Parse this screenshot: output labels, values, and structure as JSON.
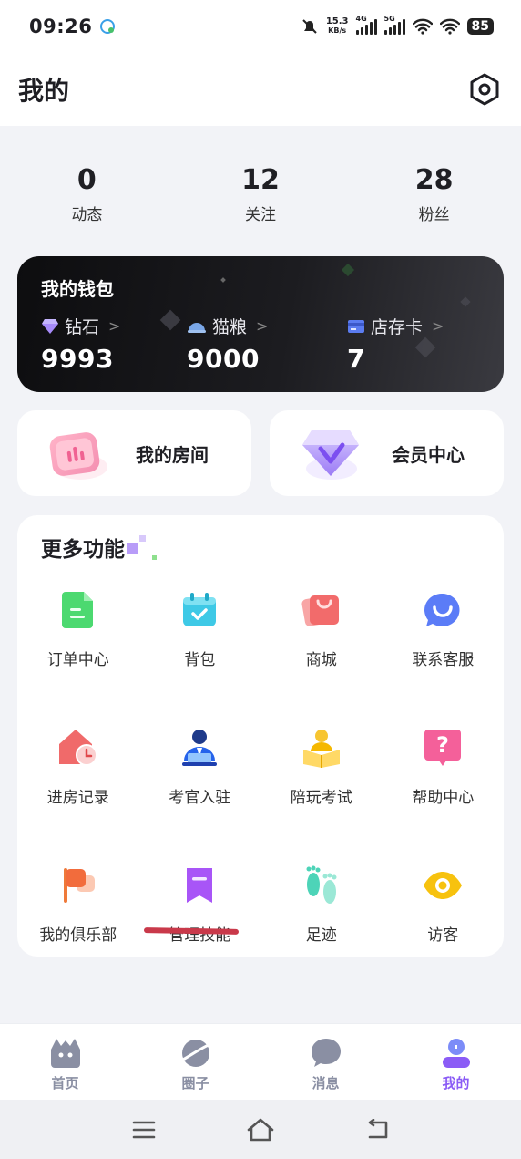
{
  "status_bar": {
    "time": "09:26",
    "net_speed_value": "15.3",
    "net_speed_unit": "KB/s",
    "sim1_type": "4G",
    "sim2_type": "5G",
    "battery": "85"
  },
  "header": {
    "title": "我的"
  },
  "stats": [
    {
      "value": "0",
      "label": "动态"
    },
    {
      "value": "12",
      "label": "关注"
    },
    {
      "value": "28",
      "label": "粉丝"
    }
  ],
  "wallet": {
    "title": "我的钱包",
    "items": [
      {
        "label": "钻石",
        "value": "9993",
        "icon": "diamond-icon"
      },
      {
        "label": "猫粮",
        "value": "9000",
        "icon": "cat-food-icon"
      },
      {
        "label": "店存卡",
        "value": "7",
        "icon": "store-card-icon"
      }
    ]
  },
  "cards": {
    "room": "我的房间",
    "vip": "会员中心"
  },
  "more": {
    "title": "更多功能",
    "items": [
      {
        "label": "订单中心",
        "icon": "order-icon"
      },
      {
        "label": "背包",
        "icon": "backpack-icon"
      },
      {
        "label": "商城",
        "icon": "shop-bag-icon"
      },
      {
        "label": "联系客服",
        "icon": "customer-service-icon"
      },
      {
        "label": "进房记录",
        "icon": "room-history-icon"
      },
      {
        "label": "考官入驻",
        "icon": "examiner-icon"
      },
      {
        "label": "陪玩考试",
        "icon": "exam-icon"
      },
      {
        "label": "帮助中心",
        "icon": "help-icon"
      },
      {
        "label": "我的俱乐部",
        "icon": "club-flag-icon"
      },
      {
        "label": "管理技能",
        "icon": "skill-bookmark-icon"
      },
      {
        "label": "足迹",
        "icon": "footprint-icon"
      },
      {
        "label": "访客",
        "icon": "visitor-eye-icon"
      }
    ]
  },
  "tabs": [
    {
      "label": "首页",
      "icon": "home-icon",
      "active": false
    },
    {
      "label": "圈子",
      "icon": "planet-icon",
      "active": false
    },
    {
      "label": "消息",
      "icon": "message-icon",
      "active": false
    },
    {
      "label": "我的",
      "icon": "profile-icon",
      "active": true
    }
  ],
  "colors": {
    "accent": "#8b5cf6",
    "tab_inactive": "#8a8fa3",
    "annotation_underline": "#c9394a"
  }
}
